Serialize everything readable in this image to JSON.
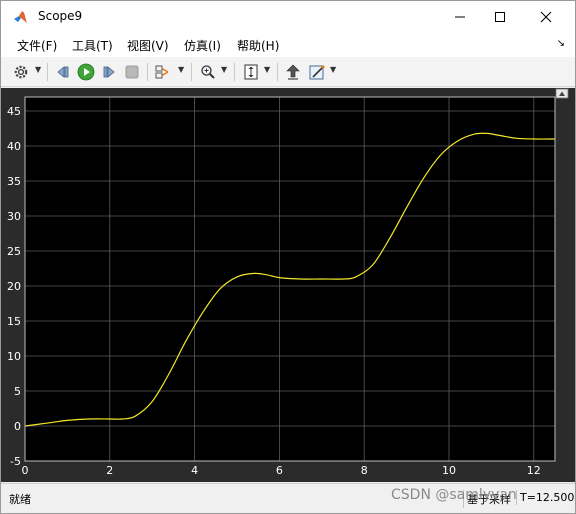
{
  "window": {
    "title": "Scope9"
  },
  "menu": {
    "items": [
      {
        "label": "文件(F)"
      },
      {
        "label": "工具(T)"
      },
      {
        "label": "视图(V)"
      },
      {
        "label": "仿真(I)"
      },
      {
        "label": "帮助(H)"
      }
    ]
  },
  "toolbar": {
    "icons": [
      "settings-icon",
      "step-back-icon",
      "run-icon",
      "step-forward-icon",
      "stop-icon",
      "signal-icon",
      "zoom-icon",
      "scale-axes-icon",
      "highlight-block-icon",
      "style-icon"
    ]
  },
  "status": {
    "ready": "就绪",
    "mode": "基于采样",
    "time": "T=12.500"
  },
  "watermark": "CSDN @samlyyan",
  "colors": {
    "plot_background": "#000000",
    "frame_background": "#2b2b2b",
    "grid": "#5a5a5a",
    "signal": "#f2e82a",
    "axis_text": "#ffffff"
  },
  "chart_data": {
    "type": "line",
    "title": "",
    "xlabel": "",
    "ylabel": "",
    "xlim": [
      0,
      12.5
    ],
    "ylim": [
      -5,
      47
    ],
    "grid": true,
    "xticks": [
      0,
      2,
      4,
      6,
      8,
      10,
      12
    ],
    "yticks": [
      -5,
      0,
      5,
      10,
      15,
      20,
      25,
      30,
      35,
      40,
      45
    ],
    "series": [
      {
        "x": [
          0,
          0.5,
          1.0,
          1.5,
          2.0,
          2.3,
          2.6,
          3.0,
          3.4,
          3.8,
          4.2,
          4.6,
          5.0,
          5.4,
          5.7,
          6.0,
          6.5,
          7.0,
          7.5,
          7.8,
          8.2,
          8.6,
          9.0,
          9.4,
          9.8,
          10.2,
          10.6,
          10.9,
          11.2,
          11.6,
          12.0,
          12.5
        ],
        "y": [
          0,
          0.4,
          0.8,
          1.0,
          1.0,
          1.0,
          1.4,
          3.5,
          7.5,
          12.2,
          16.3,
          19.6,
          21.3,
          21.8,
          21.6,
          21.2,
          21.0,
          21.0,
          21.0,
          21.3,
          23.0,
          26.8,
          31.2,
          35.4,
          38.7,
          40.7,
          41.7,
          41.8,
          41.5,
          41.1,
          41.0,
          41.0
        ]
      }
    ]
  }
}
